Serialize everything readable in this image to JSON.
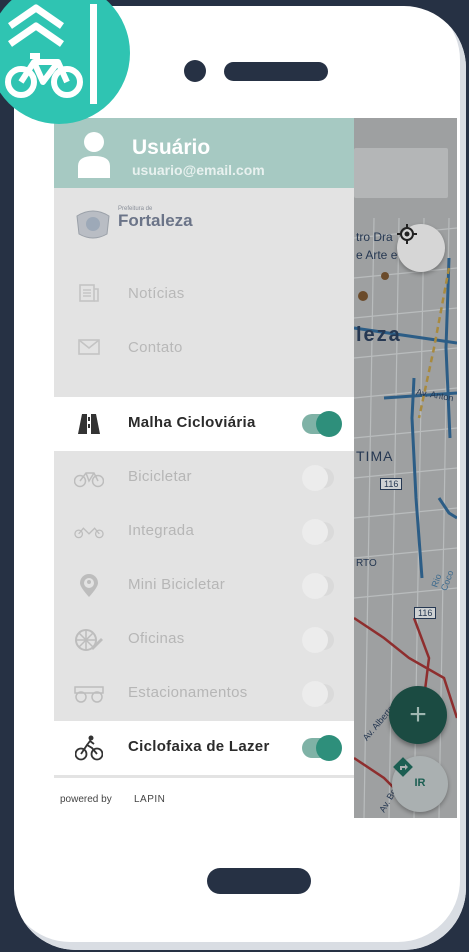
{
  "user": {
    "name": "Usuário",
    "email": "usuario@email.com"
  },
  "logo": {
    "small_text": "Prefeitura de",
    "text": "Fortaleza"
  },
  "menu": [
    {
      "label": "Notícias",
      "icon": "news-icon"
    },
    {
      "label": "Contato",
      "icon": "mail-icon"
    }
  ],
  "layers": [
    {
      "label": "Malha Cicloviária",
      "icon": "road-icon",
      "on": true
    },
    {
      "label": "Bicicletar",
      "icon": "bicycle-icon",
      "on": false
    },
    {
      "label": "Integrada",
      "icon": "tandem-bike-icon",
      "on": false
    },
    {
      "label": "Mini Bicicletar",
      "icon": "map-pin-kid-icon",
      "on": false
    },
    {
      "label": "Oficinas",
      "icon": "wrench-wheel-icon",
      "on": false
    },
    {
      "label": "Estacionamentos",
      "icon": "bike-parking-icon",
      "on": false
    },
    {
      "label": "Ciclofaixa de Lazer",
      "icon": "cyclist-icon",
      "on": true
    }
  ],
  "footer": {
    "powered_by": "powered by",
    "brand": "LAPIN"
  },
  "map": {
    "labels": [
      "tro Dra",
      "e Arte e",
      "leza",
      "Av. Anton",
      "TIMA",
      "116",
      "RTO",
      "116",
      "Rio Coco",
      "Av. Alberto",
      "Av. Bezer"
    ],
    "ir_label": "IR",
    "add_label": "+"
  },
  "colors": {
    "accent": "#2fc4b2",
    "toggle_on": "#2e8f7b",
    "header": "#a6c9c2",
    "frame": "#263144"
  }
}
